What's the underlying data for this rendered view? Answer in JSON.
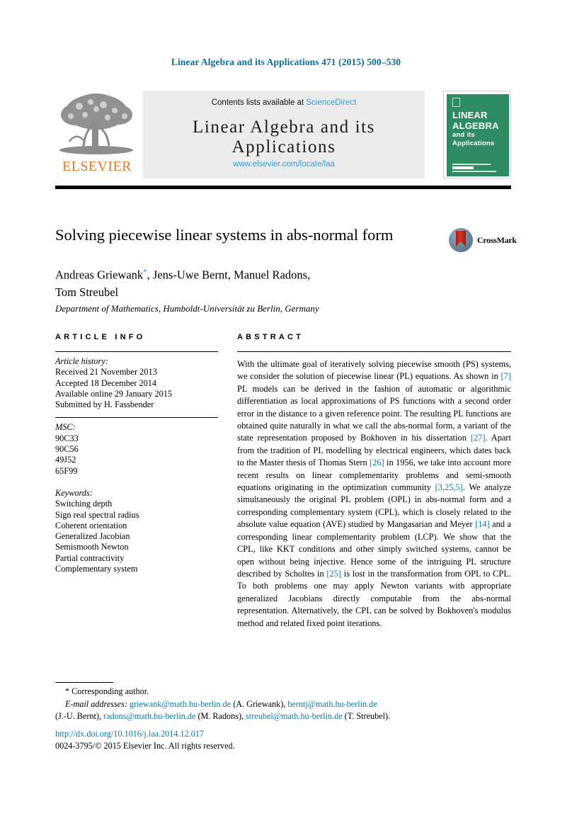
{
  "running_head": "Linear Algebra and its Applications 471 (2015) 500–530",
  "masthead": {
    "publisher_wordmark": "ELSEVIER",
    "contents_prefix": "Contents lists available at ",
    "contents_link": "ScienceDirect",
    "journal_title": "Linear Algebra and its Applications",
    "journal_url": "www.elsevier.com/locate/laa",
    "cover": {
      "line1": "LINEAR",
      "line2": "ALGEBRA",
      "line3": "and its",
      "line4": "Applications"
    }
  },
  "article": {
    "title": "Solving piecewise linear systems in abs-normal form",
    "crossmark_label": "CrossMark",
    "authors_line1": "Andreas Griewank",
    "authors_line1_mark": "*",
    "authors_line1_rest": ", Jens-Uwe Bernt, Manuel Radons,",
    "authors_line2": "Tom Streubel",
    "affiliation": "Department of Mathematics, Humboldt-Universität zu Berlin, Germany"
  },
  "sections": {
    "info_heading": "ARTICLE INFO",
    "abstract_heading": "ABSTRACT"
  },
  "info": {
    "history_label": "Article history:",
    "history": [
      "Received 21 November 2013",
      "Accepted 18 December 2014",
      "Available online 29 January 2015",
      "Submitted by H. Fassbender"
    ],
    "msc_label": "MSC:",
    "msc": [
      "90C33",
      "90C56",
      "49J52",
      "65F99"
    ],
    "keywords_label": "Keywords:",
    "keywords": [
      "Switching depth",
      "Sign real spectral radius",
      "Coherent orientation",
      "Generalized Jacobian",
      "Semismooth Newton",
      "Partial contractivity",
      "Complementary system"
    ]
  },
  "abstract": {
    "p1": "With the ultimate goal of iteratively solving piecewise smooth (PS) systems, we consider the solution of piecewise linear (PL) equations. As shown in ",
    "c1": "[7]",
    "p2": " PL models can be derived in the fashion of automatic or algorithmic differentiation as local approximations of PS functions with a second order error in the distance to a given reference point. The resulting PL functions are obtained quite naturally in what we call the abs-normal form, a variant of the state representation proposed by Bokhoven in his dissertation ",
    "c2": "[27]",
    "p3": ". Apart from the tradition of PL modelling by electrical engineers, which dates back to the Master thesis of Thomas Stern ",
    "c3": "[26]",
    "p4": " in 1956, we take into account more recent results on linear complementarity problems and semi-smooth equations originating in the optimization community ",
    "c4": "[3,25,5]",
    "p5": ". We analyze simultaneously the original PL problem (OPL) in abs-normal form and a corresponding complementary system (CPL), which is closely related to the absolute value equation (AVE) studied by Mangasarian and Meyer ",
    "c5": "[14]",
    "p6": " and a corresponding linear complementarity problem (LCP). We show that the CPL, like KKT conditions and other simply switched systems, cannot be open without being injective. Hence some of the intriguing PL structure described by Scholtes in ",
    "c6": "[25]",
    "p7": " is lost in the transformation from OPL to CPL. To both problems one may apply Newton variants with appropriate generalized Jacobians directly computable from the abs-normal representation. Alternatively, the CPL can be solved by Bokhoven's modulus method and related fixed point iterations."
  },
  "footer": {
    "corresponding_mark": "*",
    "corresponding_text": "Corresponding author.",
    "email_label": "E-mail addresses:",
    "email1": "griewank@math.hu-berlin.de",
    "name1": "(A. Griewank),",
    "email2": "berntj@math.hu-berlin.de",
    "name2": "(J.-U. Bernt),",
    "email3": "radons@math.hu-berlin.de",
    "name3": "(M. Radons),",
    "email4": "streubel@math.hu-berlin.de",
    "name4": "(T. Streubel).",
    "doi": "http://dx.doi.org/10.1016/j.laa.2014.12.017",
    "copyright": "0024-3795/© 2015 Elsevier Inc. All rights reserved."
  },
  "colors": {
    "link_blue": "#0a7ba8",
    "sciencedirect_blue": "#2f9fd0",
    "elsevier_orange": "#e87722",
    "cover_green": "#2e8b62",
    "crossmark_red": "#a81d13"
  }
}
